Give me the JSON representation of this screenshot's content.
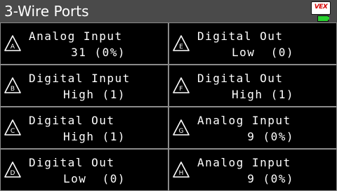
{
  "header": {
    "title": "3-Wire Ports",
    "logo_text": "VEX",
    "battery_color": "#29d12f",
    "bar_color": "#4a4a4a"
  },
  "ports": [
    {
      "letter": "A",
      "type": "Analog Input",
      "value": "31 (0%)"
    },
    {
      "letter": "E",
      "type": "Digital Out",
      "value": "Low  (0)"
    },
    {
      "letter": "B",
      "type": "Digital Input",
      "value": "High (1)"
    },
    {
      "letter": "F",
      "type": "Digital Out",
      "value": "High (1)"
    },
    {
      "letter": "C",
      "type": "Digital Out",
      "value": "High (1)"
    },
    {
      "letter": "G",
      "type": "Analog Input",
      "value": "9 (0%)"
    },
    {
      "letter": "D",
      "type": "Digital Out",
      "value": "Low  (0)"
    },
    {
      "letter": "H",
      "type": "Analog Input",
      "value": "9 (0%)"
    }
  ]
}
